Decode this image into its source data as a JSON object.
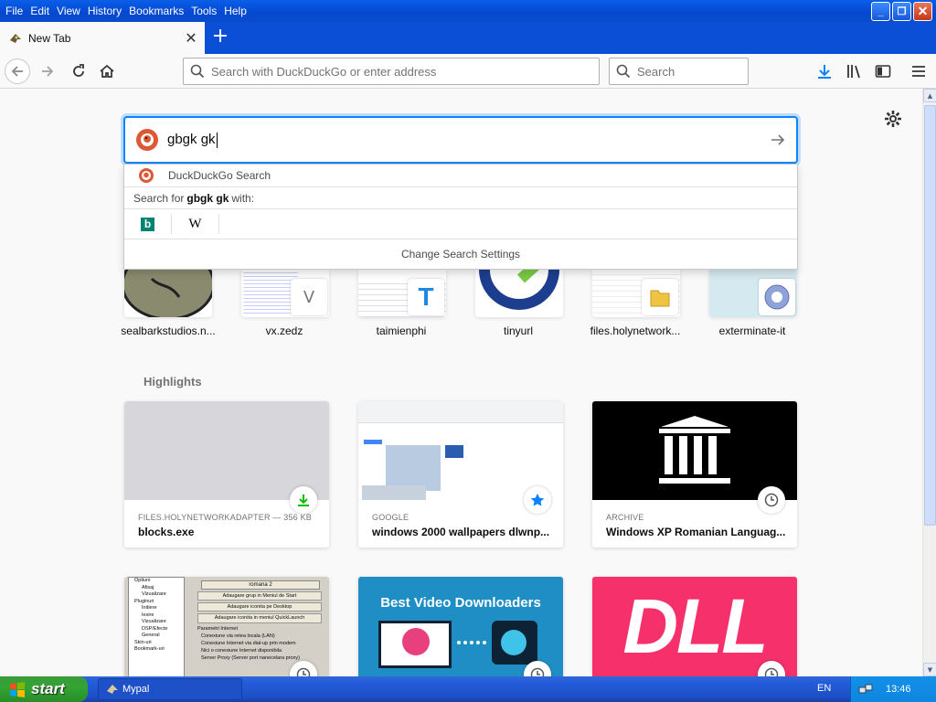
{
  "menu": [
    "File",
    "Edit",
    "View",
    "History",
    "Bookmarks",
    "Tools",
    "Help"
  ],
  "tab": {
    "title": "New Tab"
  },
  "urlbar": {
    "placeholder": "Search with DuckDuckGo or enter address"
  },
  "searchbar": {
    "placeholder": "Search"
  },
  "bigsearch": {
    "value": "gbgk gk"
  },
  "dropdown": {
    "engine_label": "DuckDuckGo Search",
    "search_for_prefix": "Search for",
    "search_term": "gbgk gk",
    "search_for_suffix": "with:",
    "engines": [
      "bing-icon",
      "wikipedia-icon"
    ],
    "change_settings": "Change Search Settings"
  },
  "top_sites": [
    "sealbarkstudios.n...",
    "vx.zedz",
    "taimienphi",
    "tinyurl",
    "files.holynetwork...",
    "exterminate-it"
  ],
  "highlights_title": "Highlights",
  "highlights": [
    {
      "source": "FILES.HOLYNETWORKADAPTER — 356 KB",
      "title": "blocks.exe",
      "badge": "download-icon"
    },
    {
      "source": "GOOGLE",
      "title": "windows 2000 wallpapers dlwnp...",
      "badge": "bookmark-star-icon"
    },
    {
      "source": "ARCHIVE",
      "title": "Windows XP Romanian Languag...",
      "badge": "history-clock-icon"
    }
  ],
  "lower_cards": [
    {
      "thumb_text": "romana 2",
      "items": [
        "Adaugare grup in Meniul de Start",
        "Adaugare iconita pe Desktop",
        "Adaugare iconita in meniul QuickLaunch",
        "Parametri Internet",
        "Conexiune via retea locala (LAN)",
        "Conexiune Internet via dial-up prin modem",
        "Nici o conexiune Internet disponibila",
        "Server Proxy (Server port nanecelara proxy)"
      ],
      "tree": [
        "Optiuni",
        "Afisaj",
        "Vizualizare",
        "Pluginuri",
        "Initiere",
        "Iesire",
        "Vizualizare",
        "DSP/Efecte",
        "General",
        "Skin-uri",
        "Bookmark-uri"
      ]
    },
    {
      "thumb_text": "Best Video Downloaders"
    },
    {
      "thumb_text": "DLL"
    }
  ],
  "taskbar": {
    "start": "start",
    "task": "Mypal",
    "lang": "EN",
    "clock": "13:46"
  },
  "colors": {
    "accent": "#0a84ff",
    "ddg": "#de5833",
    "xp_blue": "#0a4fd6",
    "start_green": "#32a532",
    "dll_pink": "#f5306b"
  }
}
